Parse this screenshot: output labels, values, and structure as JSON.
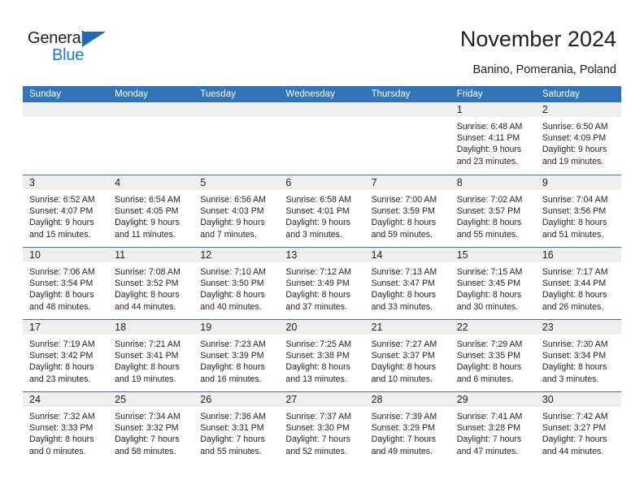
{
  "brand": {
    "name_top": "General",
    "name_bottom": "Blue",
    "triangle_color": "#1b6cb5",
    "blue_text_color": "#1b7ad1"
  },
  "header": {
    "title": "November 2024",
    "subtitle": "Banino, Pomerania, Poland"
  },
  "theme": {
    "header_blue": "#3175b8",
    "day_band_gray": "#efefef",
    "text_color": "#231f20"
  },
  "weekdays": [
    "Sunday",
    "Monday",
    "Tuesday",
    "Wednesday",
    "Thursday",
    "Friday",
    "Saturday"
  ],
  "weeks": [
    [
      {
        "day": "",
        "lines": []
      },
      {
        "day": "",
        "lines": []
      },
      {
        "day": "",
        "lines": []
      },
      {
        "day": "",
        "lines": []
      },
      {
        "day": "",
        "lines": []
      },
      {
        "day": "1",
        "lines": [
          "Sunrise: 6:48 AM",
          "Sunset: 4:11 PM",
          "Daylight: 9 hours",
          "and 23 minutes."
        ]
      },
      {
        "day": "2",
        "lines": [
          "Sunrise: 6:50 AM",
          "Sunset: 4:09 PM",
          "Daylight: 9 hours",
          "and 19 minutes."
        ]
      }
    ],
    [
      {
        "day": "3",
        "lines": [
          "Sunrise: 6:52 AM",
          "Sunset: 4:07 PM",
          "Daylight: 9 hours",
          "and 15 minutes."
        ]
      },
      {
        "day": "4",
        "lines": [
          "Sunrise: 6:54 AM",
          "Sunset: 4:05 PM",
          "Daylight: 9 hours",
          "and 11 minutes."
        ]
      },
      {
        "day": "5",
        "lines": [
          "Sunrise: 6:56 AM",
          "Sunset: 4:03 PM",
          "Daylight: 9 hours",
          "and 7 minutes."
        ]
      },
      {
        "day": "6",
        "lines": [
          "Sunrise: 6:58 AM",
          "Sunset: 4:01 PM",
          "Daylight: 9 hours",
          "and 3 minutes."
        ]
      },
      {
        "day": "7",
        "lines": [
          "Sunrise: 7:00 AM",
          "Sunset: 3:59 PM",
          "Daylight: 8 hours",
          "and 59 minutes."
        ]
      },
      {
        "day": "8",
        "lines": [
          "Sunrise: 7:02 AM",
          "Sunset: 3:57 PM",
          "Daylight: 8 hours",
          "and 55 minutes."
        ]
      },
      {
        "day": "9",
        "lines": [
          "Sunrise: 7:04 AM",
          "Sunset: 3:56 PM",
          "Daylight: 8 hours",
          "and 51 minutes."
        ]
      }
    ],
    [
      {
        "day": "10",
        "lines": [
          "Sunrise: 7:06 AM",
          "Sunset: 3:54 PM",
          "Daylight: 8 hours",
          "and 48 minutes."
        ]
      },
      {
        "day": "11",
        "lines": [
          "Sunrise: 7:08 AM",
          "Sunset: 3:52 PM",
          "Daylight: 8 hours",
          "and 44 minutes."
        ]
      },
      {
        "day": "12",
        "lines": [
          "Sunrise: 7:10 AM",
          "Sunset: 3:50 PM",
          "Daylight: 8 hours",
          "and 40 minutes."
        ]
      },
      {
        "day": "13",
        "lines": [
          "Sunrise: 7:12 AM",
          "Sunset: 3:49 PM",
          "Daylight: 8 hours",
          "and 37 minutes."
        ]
      },
      {
        "day": "14",
        "lines": [
          "Sunrise: 7:13 AM",
          "Sunset: 3:47 PM",
          "Daylight: 8 hours",
          "and 33 minutes."
        ]
      },
      {
        "day": "15",
        "lines": [
          "Sunrise: 7:15 AM",
          "Sunset: 3:45 PM",
          "Daylight: 8 hours",
          "and 30 minutes."
        ]
      },
      {
        "day": "16",
        "lines": [
          "Sunrise: 7:17 AM",
          "Sunset: 3:44 PM",
          "Daylight: 8 hours",
          "and 26 minutes."
        ]
      }
    ],
    [
      {
        "day": "17",
        "lines": [
          "Sunrise: 7:19 AM",
          "Sunset: 3:42 PM",
          "Daylight: 8 hours",
          "and 23 minutes."
        ]
      },
      {
        "day": "18",
        "lines": [
          "Sunrise: 7:21 AM",
          "Sunset: 3:41 PM",
          "Daylight: 8 hours",
          "and 19 minutes."
        ]
      },
      {
        "day": "19",
        "lines": [
          "Sunrise: 7:23 AM",
          "Sunset: 3:39 PM",
          "Daylight: 8 hours",
          "and 16 minutes."
        ]
      },
      {
        "day": "20",
        "lines": [
          "Sunrise: 7:25 AM",
          "Sunset: 3:38 PM",
          "Daylight: 8 hours",
          "and 13 minutes."
        ]
      },
      {
        "day": "21",
        "lines": [
          "Sunrise: 7:27 AM",
          "Sunset: 3:37 PM",
          "Daylight: 8 hours",
          "and 10 minutes."
        ]
      },
      {
        "day": "22",
        "lines": [
          "Sunrise: 7:29 AM",
          "Sunset: 3:35 PM",
          "Daylight: 8 hours",
          "and 6 minutes."
        ]
      },
      {
        "day": "23",
        "lines": [
          "Sunrise: 7:30 AM",
          "Sunset: 3:34 PM",
          "Daylight: 8 hours",
          "and 3 minutes."
        ]
      }
    ],
    [
      {
        "day": "24",
        "lines": [
          "Sunrise: 7:32 AM",
          "Sunset: 3:33 PM",
          "Daylight: 8 hours",
          "and 0 minutes."
        ]
      },
      {
        "day": "25",
        "lines": [
          "Sunrise: 7:34 AM",
          "Sunset: 3:32 PM",
          "Daylight: 7 hours",
          "and 58 minutes."
        ]
      },
      {
        "day": "26",
        "lines": [
          "Sunrise: 7:36 AM",
          "Sunset: 3:31 PM",
          "Daylight: 7 hours",
          "and 55 minutes."
        ]
      },
      {
        "day": "27",
        "lines": [
          "Sunrise: 7:37 AM",
          "Sunset: 3:30 PM",
          "Daylight: 7 hours",
          "and 52 minutes."
        ]
      },
      {
        "day": "28",
        "lines": [
          "Sunrise: 7:39 AM",
          "Sunset: 3:29 PM",
          "Daylight: 7 hours",
          "and 49 minutes."
        ]
      },
      {
        "day": "29",
        "lines": [
          "Sunrise: 7:41 AM",
          "Sunset: 3:28 PM",
          "Daylight: 7 hours",
          "and 47 minutes."
        ]
      },
      {
        "day": "30",
        "lines": [
          "Sunrise: 7:42 AM",
          "Sunset: 3:27 PM",
          "Daylight: 7 hours",
          "and 44 minutes."
        ]
      }
    ]
  ]
}
